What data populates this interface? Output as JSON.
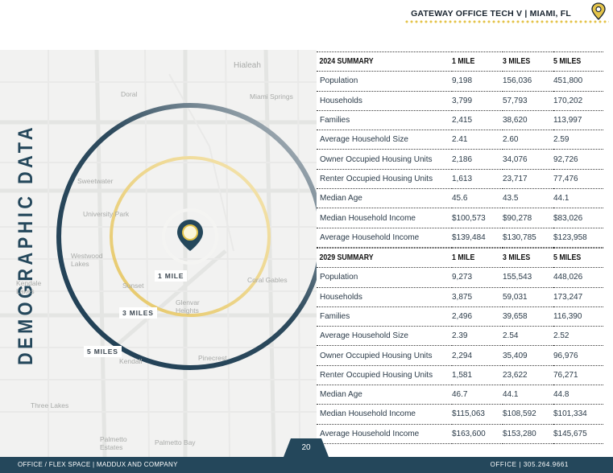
{
  "header": {
    "title": "GATEWAY OFFICE TECH V | MIAMI, FL"
  },
  "vertical_title": "DEMOGRAPHIC DATA",
  "map": {
    "place_labels": [
      "Hialeah",
      "Doral",
      "Miami Springs",
      "Sweetwater",
      "University Park",
      "Westwood Lakes",
      "Kendale Lakes",
      "Sunset",
      "Coral Gables",
      "Glenvar Heights",
      "Kendall",
      "Pinecrest",
      "Three Lakes",
      "Palmetto Estates",
      "Palmetto Bay"
    ],
    "ring_labels": [
      "1 MILE",
      "3 MILES",
      "5 MILES"
    ]
  },
  "summary_2024": {
    "title": "2024 SUMMARY",
    "columns": [
      "1 MILE",
      "3 MILES",
      "5 MILES"
    ],
    "rows": [
      {
        "label": "Population",
        "v1": "9,198",
        "v3": "156,036",
        "v5": "451,800"
      },
      {
        "label": "Households",
        "v1": "3,799",
        "v3": "57,793",
        "v5": "170,202"
      },
      {
        "label": "Families",
        "v1": "2,415",
        "v3": "38,620",
        "v5": "113,997"
      },
      {
        "label": "Average Household Size",
        "v1": "2.41",
        "v3": "2.60",
        "v5": "2.59"
      },
      {
        "label": "Owner Occupied Housing Units",
        "v1": "2,186",
        "v3": "34,076",
        "v5": "92,726"
      },
      {
        "label": "Renter Occupied Housing Units",
        "v1": "1,613",
        "v3": "23,717",
        "v5": "77,476"
      },
      {
        "label": "Median Age",
        "v1": "45.6",
        "v3": "43.5",
        "v5": "44.1"
      },
      {
        "label": "Median Household Income",
        "v1": "$100,573",
        "v3": "$90,278",
        "v5": "$83,026"
      },
      {
        "label": "Average Household Income",
        "v1": "$139,484",
        "v3": "$130,785",
        "v5": "$123,958"
      }
    ]
  },
  "summary_2029": {
    "title": "2029 SUMMARY",
    "columns": [
      "1 MILE",
      "3 MILES",
      "5 MILES"
    ],
    "rows": [
      {
        "label": "Population",
        "v1": "9,273",
        "v3": "155,543",
        "v5": "448,026"
      },
      {
        "label": "Households",
        "v1": "3,875",
        "v3": "59,031",
        "v5": "173,247"
      },
      {
        "label": "Families",
        "v1": "2,496",
        "v3": "39,658",
        "v5": "116,390"
      },
      {
        "label": "Average Household Size",
        "v1": "2.39",
        "v3": "2.54",
        "v5": "2.52"
      },
      {
        "label": "Owner Occupied Housing Units",
        "v1": "2,294",
        "v3": "35,409",
        "v5": "96,976"
      },
      {
        "label": "Renter Occupied Housing Units",
        "v1": "1,581",
        "v3": "23,622",
        "v5": "76,271"
      },
      {
        "label": "Median Age",
        "v1": "46.7",
        "v3": "44.1",
        "v5": "44.8"
      },
      {
        "label": "Median Household Income",
        "v1": "$115,063",
        "v3": "$108,592",
        "v5": "$101,334"
      },
      {
        "label": "Average Household Income",
        "v1": "$163,600",
        "v3": "$153,280",
        "v5": "$145,675"
      }
    ]
  },
  "footer": {
    "left": "OFFICE / FLEX SPACE  |  MADDUX AND COMPANY",
    "right": "OFFICE  |  305.264.9661",
    "page_number": "20"
  },
  "colors": {
    "navy": "#24475b",
    "gold": "#e4c44a",
    "text": "#2a3a48"
  }
}
